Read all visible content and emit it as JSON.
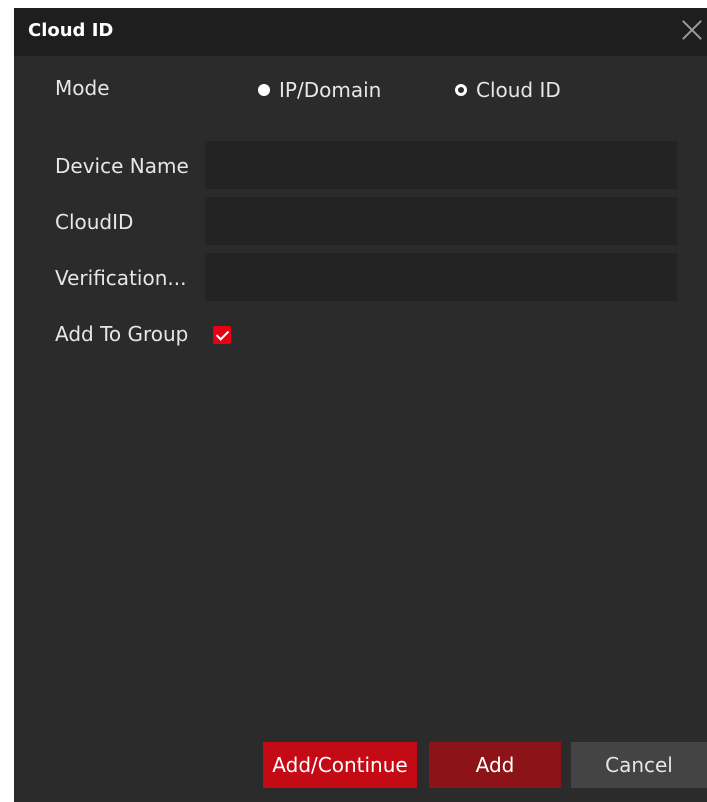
{
  "dialog": {
    "title": "Cloud ID",
    "close_icon": "close-icon"
  },
  "mode": {
    "label": "Mode",
    "options": [
      {
        "label": "IP/Domain",
        "selected": true
      },
      {
        "label": "Cloud ID",
        "selected": false
      }
    ]
  },
  "fields": {
    "device_name": {
      "label": "Device Name",
      "value": ""
    },
    "cloud_id": {
      "label": "CloudID",
      "value": ""
    },
    "verification": {
      "label": "Verification...",
      "value": ""
    }
  },
  "add_to_group": {
    "label": "Add To Group",
    "checked": true
  },
  "buttons": {
    "add_continue": "Add/Continue",
    "add": "Add",
    "cancel": "Cancel"
  },
  "colors": {
    "accent": "#e60012",
    "background": "#2b2b2b",
    "titlebar": "#1e1e1e"
  }
}
